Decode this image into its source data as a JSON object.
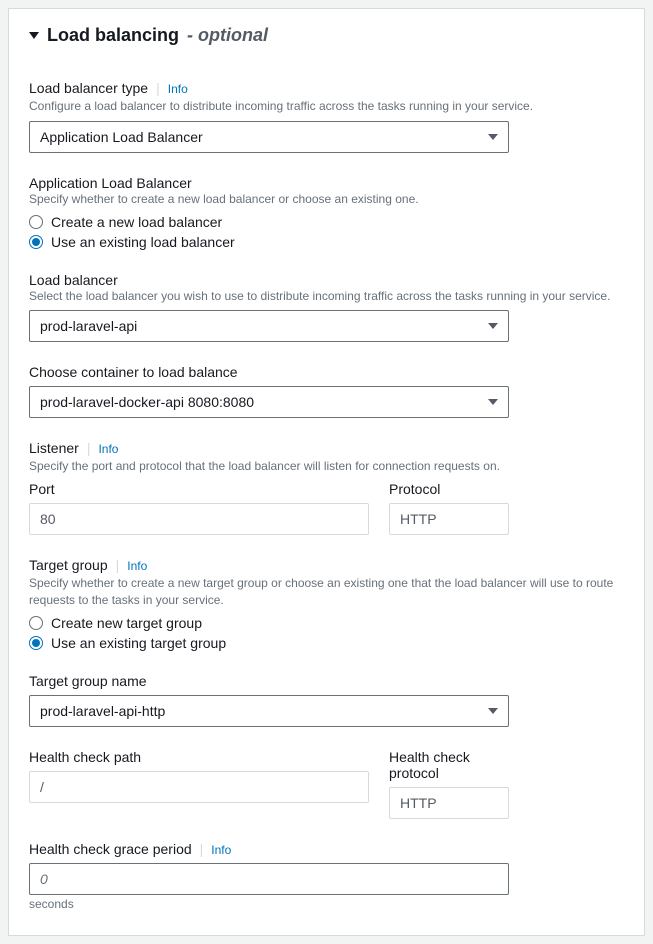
{
  "header": {
    "title": "Load balancing",
    "optional": "- optional"
  },
  "lb_type": {
    "label": "Load balancer type",
    "info": "Info",
    "hint": "Configure a load balancer to distribute incoming traffic across the tasks running in your service.",
    "value": "Application Load Balancer"
  },
  "alb": {
    "label": "Application Load Balancer",
    "hint": "Specify whether to create a new load balancer or choose an existing one.",
    "opt_create": "Create a new load balancer",
    "opt_existing": "Use an existing load balancer"
  },
  "lb": {
    "label": "Load balancer",
    "hint": "Select the load balancer you wish to use to distribute incoming traffic across the tasks running in your service.",
    "value": "prod-laravel-api"
  },
  "container": {
    "label": "Choose container to load balance",
    "value": "prod-laravel-docker-api 8080:8080"
  },
  "listener": {
    "label": "Listener",
    "info": "Info",
    "hint": "Specify the port and protocol that the load balancer will listen for connection requests on.",
    "port_label": "Port",
    "port_value": "80",
    "protocol_label": "Protocol",
    "protocol_value": "HTTP"
  },
  "tg": {
    "label": "Target group",
    "info": "Info",
    "hint": "Specify whether to create a new target group or choose an existing one that the load balancer will use to route requests to the tasks in your service.",
    "opt_create": "Create new target group",
    "opt_existing": "Use an existing target group"
  },
  "tg_name": {
    "label": "Target group name",
    "value": "prod-laravel-api-http"
  },
  "hc": {
    "path_label": "Health check path",
    "path_value": "/",
    "protocol_label": "Health check protocol",
    "protocol_value": "HTTP"
  },
  "grace": {
    "label": "Health check grace period",
    "info": "Info",
    "value": "0",
    "unit": "seconds"
  }
}
